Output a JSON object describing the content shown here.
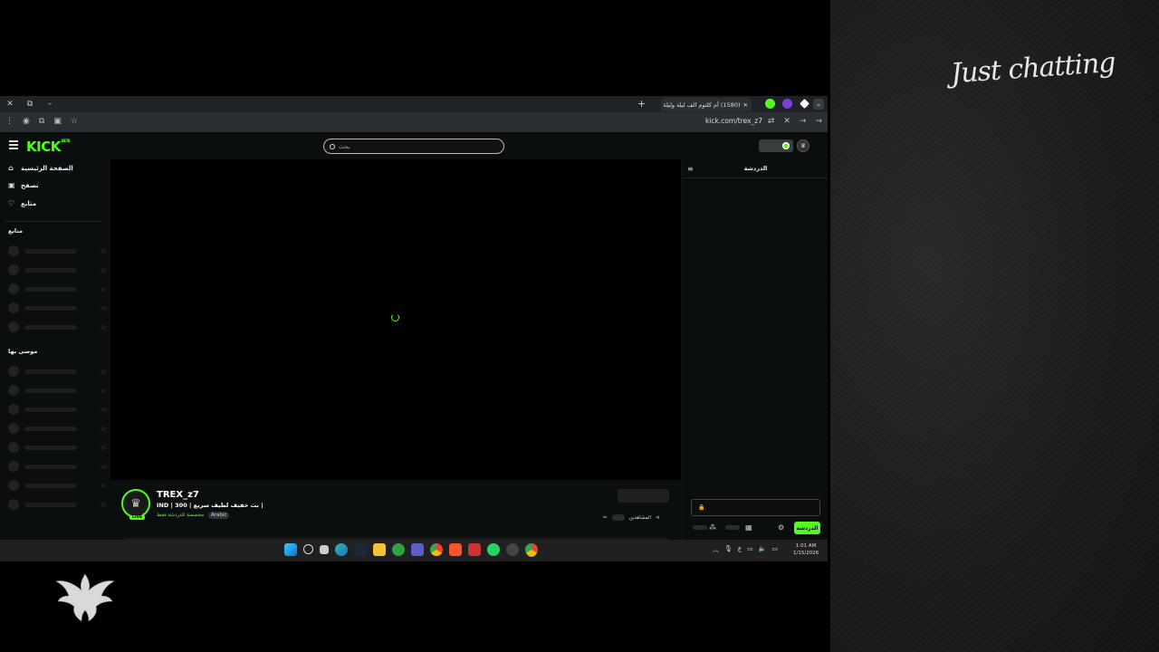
{
  "overlay": {
    "category_text": "Just chatting"
  },
  "browser": {
    "tab": {
      "title": "(1580) أم كلثوم الف ليلة وليلة"
    },
    "new_tab_symbol": "+",
    "dropdown_symbol": "⌄",
    "url": "kick.com/trex_z7",
    "window_controls": [
      "×",
      "▢",
      "–"
    ]
  },
  "kick": {
    "logo": "KICK",
    "logo_badge": "BETA",
    "search": {
      "placeholder": "بحث"
    },
    "nav": [
      {
        "label": "الصفحة الرئيسية",
        "icon": "home-icon"
      },
      {
        "label": "تصفح",
        "icon": "browse-icon"
      },
      {
        "label": "متابع",
        "icon": "heart-icon"
      }
    ],
    "sections": {
      "following": "متابع",
      "recommended": "موصى بها"
    },
    "stream": {
      "streamer_name": "TREX_z7",
      "title": "IND | 300 | بث خفيف لطيف سريع |",
      "category": "مخصصة للدردشة فقط",
      "language_tag": "Arabic",
      "live_badge": "LIVE",
      "viewers_label": "المشاهدين"
    },
    "chat": {
      "title": "الدردشة",
      "send_label": "الدردشة"
    }
  },
  "taskbar": {
    "clock_time": "1:01 AM",
    "clock_date": "1/15/2026",
    "lang": "ع"
  },
  "colors": {
    "accent": "#53fc18",
    "background": "#0b0e0f"
  }
}
